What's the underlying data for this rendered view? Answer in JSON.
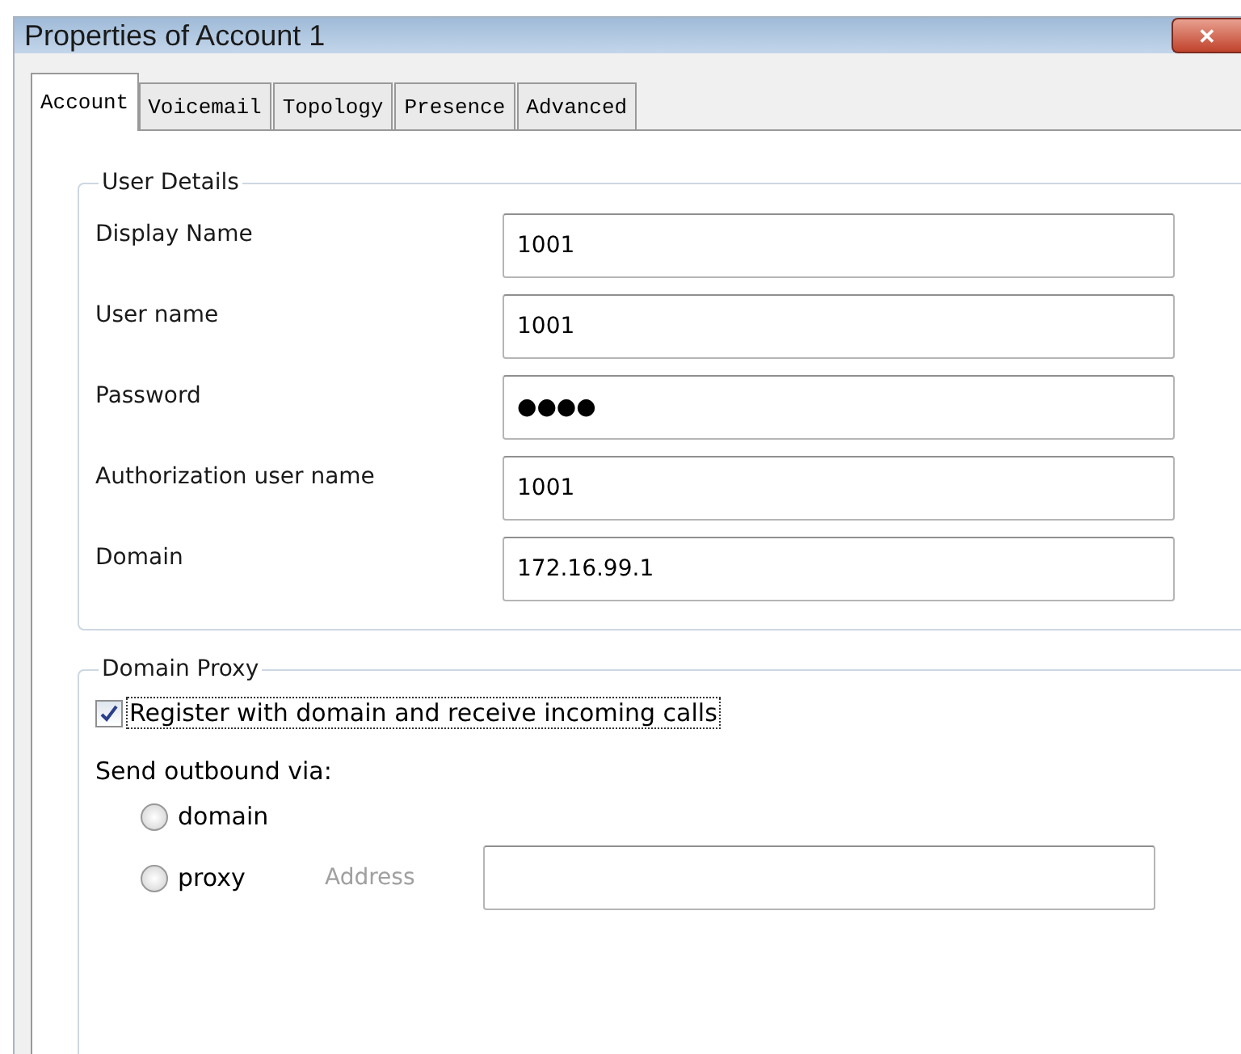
{
  "window": {
    "title": "Properties of Account 1",
    "close": "✕"
  },
  "tabs": [
    {
      "label": "Account",
      "selected": true
    },
    {
      "label": "Voicemail",
      "selected": false
    },
    {
      "label": "Topology",
      "selected": false
    },
    {
      "label": "Presence",
      "selected": false
    },
    {
      "label": "Advanced",
      "selected": false
    }
  ],
  "user_details": {
    "title": "User Details",
    "fields": [
      {
        "label": "Display Name",
        "value": "1001"
      },
      {
        "label": "User name",
        "value": "1001"
      },
      {
        "label": "Password",
        "value": "●●●●"
      },
      {
        "label": "Authorization user name",
        "value": "1001"
      },
      {
        "label": "Domain",
        "value": "172.16.99.1"
      }
    ]
  },
  "domain_proxy": {
    "title": "Domain Proxy",
    "register": {
      "label": "Register with domain and receive incoming calls",
      "checked": true
    },
    "send_label": "Send outbound via:",
    "options": [
      {
        "label": "domain",
        "selected": false
      },
      {
        "label": "proxy",
        "selected": false
      }
    ],
    "address": {
      "label": "Address",
      "disabled": true
    }
  }
}
